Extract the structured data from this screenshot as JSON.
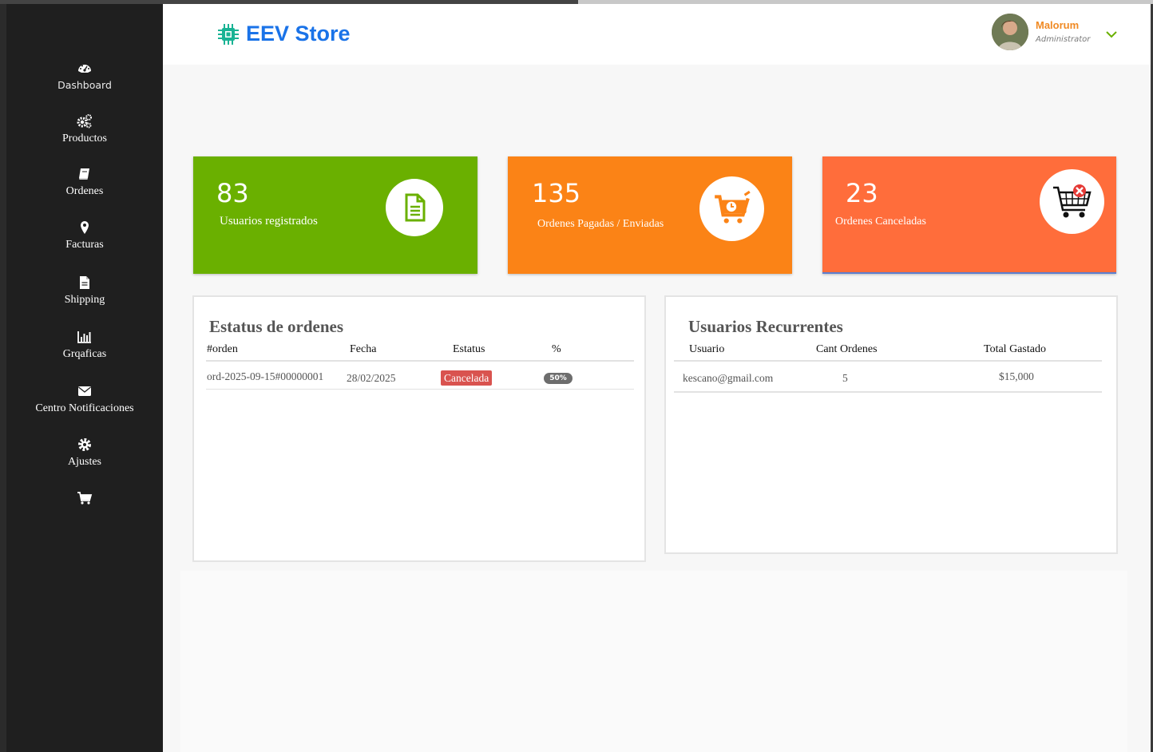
{
  "sidebar": {
    "items": [
      {
        "label": "Dashboard",
        "icon": "dashboard-icon"
      },
      {
        "label": "Productos",
        "icon": "gears-icon"
      },
      {
        "label": "Ordenes",
        "icon": "book-icon"
      },
      {
        "label": "Facturas",
        "icon": "map-marker-icon"
      },
      {
        "label": "Shipping",
        "icon": "file-icon"
      },
      {
        "label": "Grqaficas",
        "icon": "bar-chart-icon"
      },
      {
        "label": "Centro Notificaciones",
        "icon": "envelope-icon"
      },
      {
        "label": "Ajustes",
        "icon": "gear-icon"
      },
      {
        "label": "",
        "icon": "cart-icon"
      }
    ]
  },
  "header": {
    "brand": "EEV Store",
    "brand_icon": "chip-icon",
    "user_name": "Malorum",
    "user_role": "Administrator"
  },
  "cards": [
    {
      "value": "83",
      "label": "Usuarios registrados",
      "icon": "document-icon",
      "color": "#6ab000"
    },
    {
      "value": "135",
      "label": "Ordenes Pagadas / Enviadas",
      "icon": "cart-clock-icon",
      "color": "#fb8316"
    },
    {
      "value": "23",
      "label": "Ordenes Canceladas",
      "icon": "cart-cancel-icon",
      "color": "#ff6d3b"
    }
  ],
  "orders_panel": {
    "title": "Estatus de ordenes",
    "columns": [
      "#orden",
      "Fecha",
      "Estatus",
      "%"
    ],
    "rows": [
      {
        "orden": "ord-2025-09-15#00000001",
        "fecha": "28/02/2025",
        "estatus": "Cancelada",
        "pct": "50%"
      }
    ]
  },
  "users_panel": {
    "title": "Usuarios Recurrentes",
    "columns": [
      "Usuario",
      "Cant Ordenes",
      "Total Gastado"
    ],
    "rows": [
      {
        "usuario": "kescano@gmail.com",
        "cant": "5",
        "total": "$15,000"
      }
    ]
  },
  "colors": {
    "accent_blue": "#1a73e8",
    "user_orange": "#f08a24",
    "status_red": "#d9534f",
    "sidebar_bg": "#1f1f1f"
  }
}
